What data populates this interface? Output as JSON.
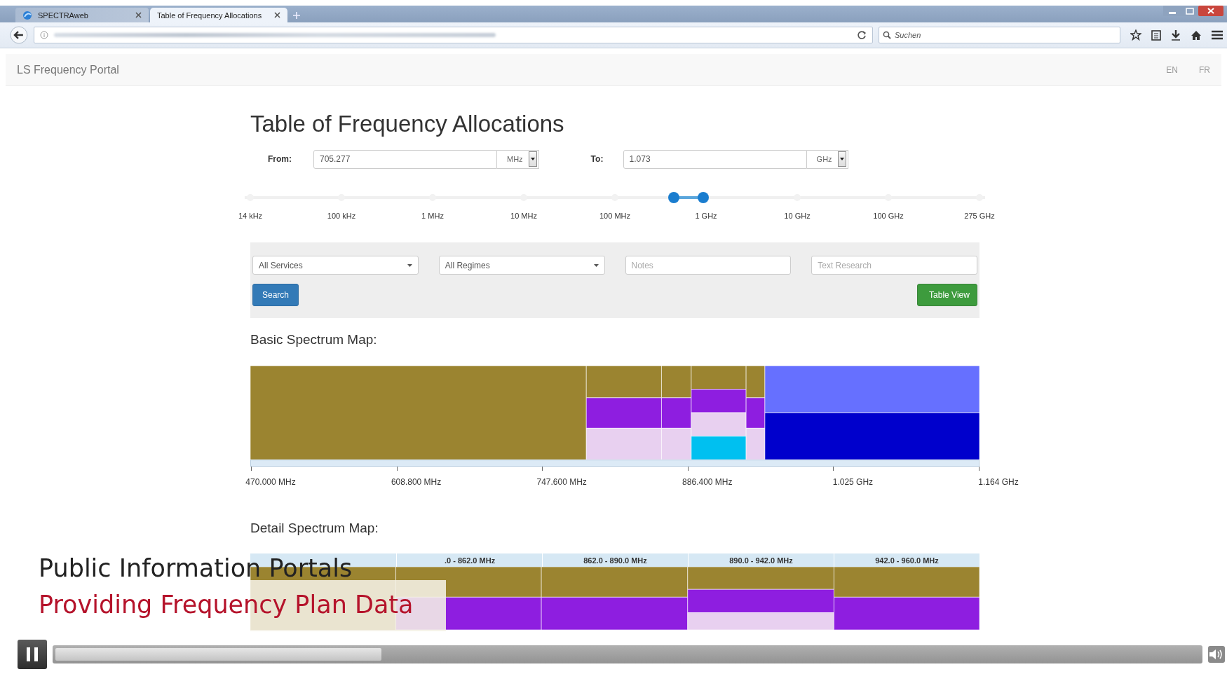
{
  "browser": {
    "tabs": [
      {
        "label": "SPECTRAweb",
        "selected": false
      },
      {
        "label": "Table of Frequency Allocations",
        "selected": true
      }
    ],
    "search": {
      "placeholder": "Suchen"
    }
  },
  "site": {
    "brand": "LS Frequency Portal",
    "languages": [
      {
        "label": "EN"
      },
      {
        "label": "FR"
      }
    ]
  },
  "page": {
    "title": "Table of Frequency Allocations"
  },
  "range": {
    "from": {
      "label": "From:",
      "value": "705.277",
      "unit": "MHz"
    },
    "to": {
      "label": "To:",
      "value": "1.073",
      "unit": "GHz"
    }
  },
  "slider": {
    "ticks": [
      "14 kHz",
      "100 kHz",
      "1 MHz",
      "10 MHz",
      "100 MHz",
      "1 GHz",
      "10 GHz",
      "100 GHz",
      "275 GHz"
    ],
    "thumbs": [
      {
        "level": 0.581
      },
      {
        "level": 0.621
      }
    ]
  },
  "filters": {
    "services": "All Services",
    "regimes": "All Regimes",
    "notes_placeholder": "Notes",
    "text_placeholder": "Text Research",
    "search_button": "Search",
    "table_view_button": "Table View"
  },
  "basic_map": {
    "heading": "Basic Spectrum Map:",
    "axis_labels": [
      "470.000 MHz",
      "608.800 MHz",
      "747.600 MHz",
      "886.400 MHz",
      "1.025 GHz",
      "1.164 GHz"
    ]
  },
  "detail_map": {
    "heading": "Detail Spectrum Map:",
    "band_labels": [
      ".0 - 862.0 MHz",
      "862.0 - 890.0 MHz",
      "890.0 - 942.0 MHz",
      "942.0 - 960.0 MHz"
    ]
  },
  "video_overlay": {
    "title": "Public Information Portals",
    "subtitle": "Providing Frequency Plan Data"
  },
  "player": {
    "playing": true,
    "progress": {
      "level": 0.286
    }
  }
}
